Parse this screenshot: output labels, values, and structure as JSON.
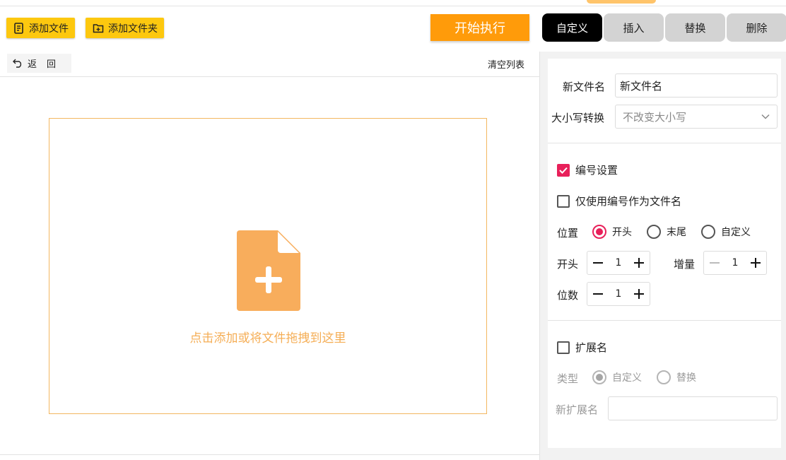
{
  "toolbar": {
    "add_file": "添加文件",
    "add_folder": "添加文件夹",
    "start": "开始执行"
  },
  "tabs": [
    {
      "label": "自定义",
      "active": true
    },
    {
      "label": "插入",
      "active": false
    },
    {
      "label": "替换",
      "active": false
    },
    {
      "label": "删除",
      "active": false
    }
  ],
  "list": {
    "back": "返回",
    "clear": "清空列表",
    "drop_text": "点击添加或将文件拖拽到这里"
  },
  "panel": {
    "new_name_label": "新文件名",
    "new_name_value": "新文件名",
    "case_label": "大小写转换",
    "case_value": "不改变大小写",
    "numbering": {
      "label": "编号设置",
      "checked": true,
      "only_number_label": "仅使用编号作为文件名",
      "position_label": "位置",
      "positions": [
        "开头",
        "末尾",
        "自定义"
      ],
      "position_selected": "开头",
      "start_label": "开头",
      "start_value": "1",
      "increment_label": "增量",
      "increment_value": "1",
      "digits_label": "位数",
      "digits_value": "1"
    },
    "extension": {
      "label": "扩展名",
      "type_label": "类型",
      "types": [
        "自定义",
        "替换"
      ],
      "type_selected": "自定义",
      "new_ext_label": "新扩展名",
      "new_ext_value": ""
    }
  },
  "colors": {
    "toolbar_button": "#fdc80f",
    "start_button": "#ff9b0a",
    "accent": "#e8205a",
    "drop_border": "#f3b760",
    "drop_icon": "#f8ad5c"
  }
}
